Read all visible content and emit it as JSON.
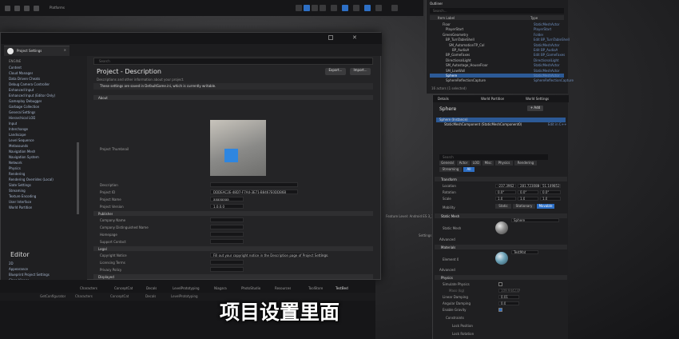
{
  "toolbar": {
    "platforms": "Platforms"
  },
  "project_settings": {
    "tab_label": "Project Settings",
    "sidebar_section": "ENGINE",
    "sidebar_items": [
      "Content",
      "Cloud Manager",
      "Data Driven Cheats",
      "Debug Camera Controller",
      "Enhanced Input",
      "Enhanced Input (Editor Only)",
      "Gameplay Debugger",
      "Garbage Collection",
      "General Settings",
      "Hierarchical LOD",
      "Input",
      "Interchange",
      "Landscape",
      "Level Sequence",
      "Metasounds",
      "Navigation Mesh",
      "Navigation System",
      "Network",
      "Physics",
      "Rendering",
      "Rendering Overrides (Local)",
      "Slate Settings",
      "Streaming",
      "Texture Encoding",
      "User Interface",
      "World Partition"
    ],
    "editor_heading": "Editor",
    "editor_items": [
      "2D",
      "Appearance",
      "Blueprint Project Settings",
      "Class Viewer"
    ],
    "search_placeholder": "Search",
    "page_title": "Project - Description",
    "page_subtitle": "Descriptions and other information about your project.",
    "export_label": "Export...",
    "import_label": "Import...",
    "banner": "These settings are saved in DefaultGame.ini, which is currently writable.",
    "categories": {
      "about": "About",
      "publisher": "Publisher",
      "legal": "Legal",
      "displayed": "Displayed",
      "settings": "Settings"
    },
    "labels": {
      "thumbnail": "Project Thumbnail",
      "description": "Description",
      "project_id": "Project ID",
      "project_name": "Project Name",
      "project_version": "Project Version",
      "company_name": "Company Name",
      "company_distinguished": "Company Distinguished Name",
      "homepage": "Homepage",
      "support_contact": "Support Contact",
      "copyright_notice": "Copyright Notice",
      "licensing_terms": "Licensing Terms",
      "privacy_policy": "Privacy Policy",
      "project_displayed_title": "Project Displayed Title",
      "project_debug_title": "Project Debug Title Info",
      "should_window_preserve": "Should Window Preserve Aspect Ratio"
    },
    "values": {
      "project_id": "DDDEAC2E-48D7-F7A4-3E71-B8467E0DDB6B",
      "project_name": "aaaaaaaa",
      "project_version": "1.0.0.0",
      "copyright_notice": "Fill out your copyright notice in the Description page of Project Settings."
    }
  },
  "outliner": {
    "title": "Outliner",
    "search_placeholder": "Search...",
    "col_label": "Item Label",
    "col_type": "Type",
    "rows": [
      {
        "name": "Floor",
        "type": "StaticMeshActor",
        "indent": 20,
        "selected": false
      },
      {
        "name": "PlayerStart",
        "type": "PlayerStart",
        "indent": 24,
        "selected": false
      },
      {
        "name": "GreenGeometry",
        "type": "Folder",
        "indent": 20,
        "selected": false
      },
      {
        "name": "BP_TurnTableShell",
        "type": "Edit BP_TurnTableShell",
        "indent": 24,
        "selected": false
      },
      {
        "name": "SM_AutomationTP_Cal",
        "type": "StaticMeshActor",
        "indent": 28,
        "selected": false
      },
      {
        "name": "BP_AudioA",
        "type": "Edit BP_AudioA",
        "indent": 32,
        "selected": false
      },
      {
        "name": "BP_GameFaxes",
        "type": "Edit BP_GameFaxes",
        "indent": 24,
        "selected": false
      },
      {
        "name": "DirectionalLight",
        "type": "DirectionalLight",
        "indent": 24,
        "selected": false
      },
      {
        "name": "SM_Autostage_HouseFloor",
        "type": "StaticMeshActor",
        "indent": 24,
        "selected": false
      },
      {
        "name": "SM_LowWall",
        "type": "StaticMeshActor",
        "indent": 24,
        "selected": false
      },
      {
        "name": "Sphere",
        "type": "StaticMeshActor",
        "indent": 24,
        "selected": true
      },
      {
        "name": "SphereReflectionCapture",
        "type": "SphereReflectionCapture",
        "indent": 24,
        "selected": false
      }
    ],
    "footer": "16 actors (1 selected)"
  },
  "details": {
    "tabs": [
      "Details",
      "World Partition",
      "World Settings"
    ],
    "actor_name": "Sphere",
    "add_label": "+ Add",
    "component_self": "Sphere (Instance)",
    "component_mesh": "StaticMeshComponent (StaticMeshComponent0)",
    "edit_cpp": "Edit in C++",
    "search_placeholder": "Search",
    "filters": [
      "General",
      "Actor",
      "LOD",
      "Misc",
      "Physics",
      "Rendering",
      "Streaming",
      "All"
    ],
    "transform_label": "Transform",
    "location_label": "Location",
    "rotation_label": "Rotation",
    "scale_label": "Scale",
    "location": [
      "-237.3962",
      "281.723088",
      "51.149852"
    ],
    "rotation": [
      "0.0°",
      "0.0°",
      "0.0°"
    ],
    "scale": [
      "1.0",
      "1.0",
      "1.0"
    ],
    "mobility_label": "Mobility",
    "mobility": [
      "Static",
      "Stationary",
      "Movable"
    ],
    "static_mesh_cat": "Static Mesh",
    "static_mesh_label": "Static Mesh",
    "static_mesh_value": "Sphere",
    "advanced_label": "Advanced",
    "materials_cat": "Materials",
    "element_label": "Element 0",
    "element_value": "TestMat",
    "physics_cat": "Physics",
    "simulate_label": "Simulate Physics",
    "mass_label": "Mass (kg)",
    "mass_value": "109.944237",
    "linear_damping_label": "Linear Damping",
    "linear_damping_value": "0.01",
    "angular_damping_label": "Angular Damping",
    "angular_damping_value": "0.0",
    "enable_gravity_label": "Enable Gravity",
    "constraints_label": "Constraints",
    "lock_position_label": "Lock Position",
    "lock_rotation_label": "Lock Rotation"
  },
  "drawer": {
    "tabs": [
      "GetConfigurator",
      "Characters",
      "ConceptCat",
      "Decals",
      "LevelPrototyping",
      "Niagara",
      "PhotoStudio",
      "Resources",
      "ToolStore",
      "TestBed"
    ],
    "active_tab": "TestBed"
  },
  "viewport": {
    "status": "Feature Level:  Android ES 3_1",
    "settings": "Settings"
  },
  "caption": "项目设置里面"
}
